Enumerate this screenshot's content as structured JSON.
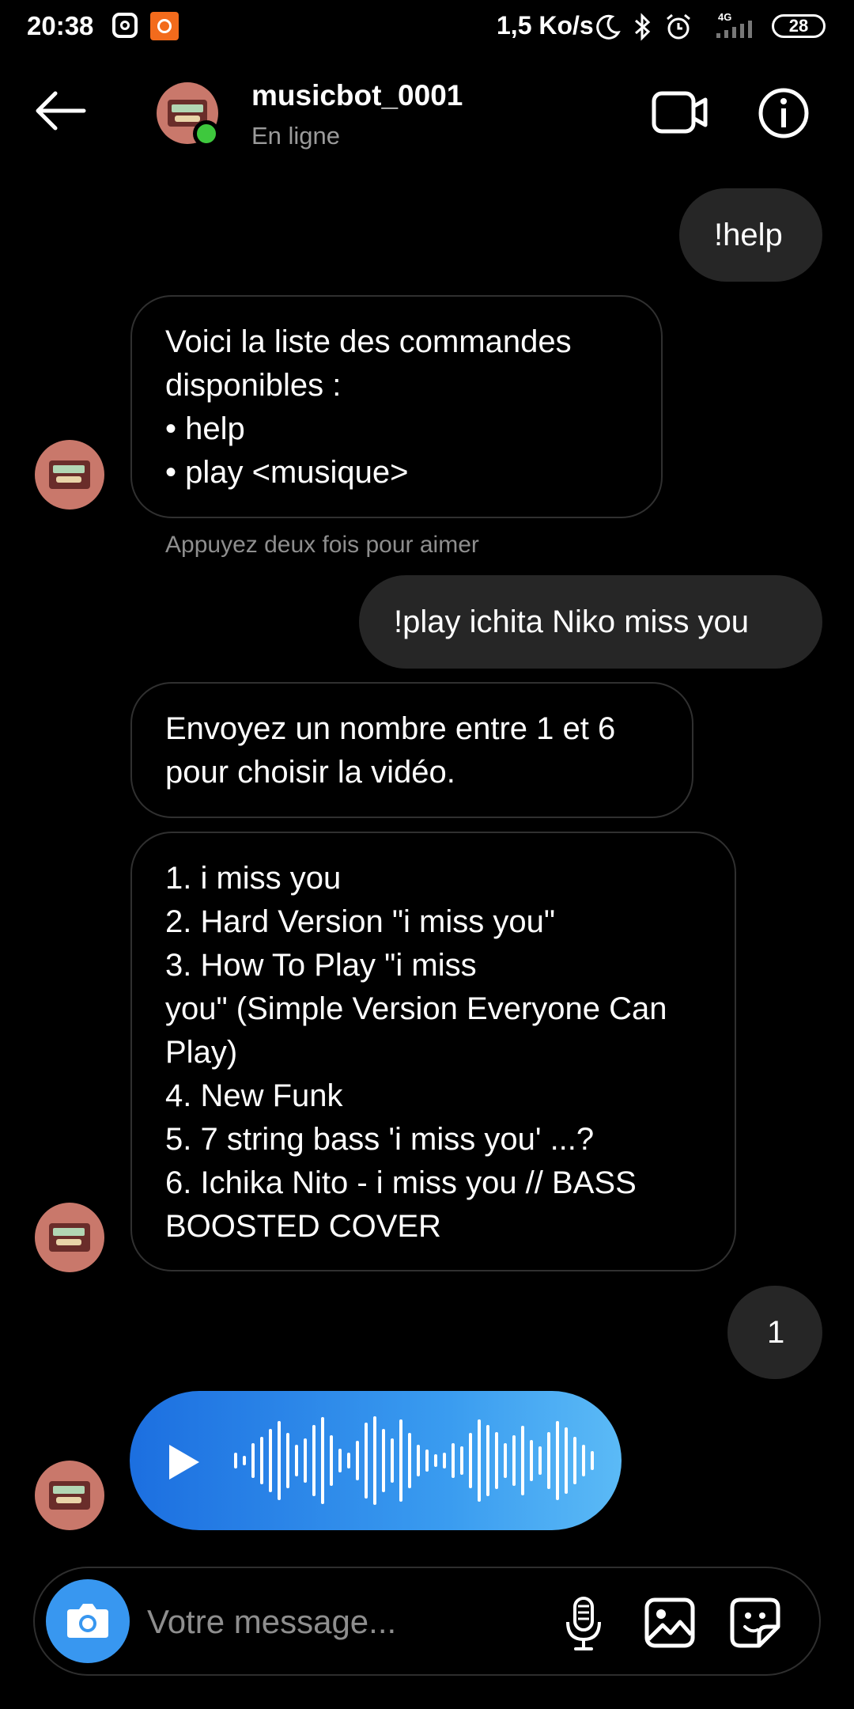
{
  "status_bar": {
    "time": "20:38",
    "net_speed": "1,5 Ko/s",
    "network_type": "4G",
    "battery": "28",
    "icons": [
      "instagram-icon",
      "mi-icon",
      "moon-icon",
      "bluetooth-icon",
      "alarm-icon",
      "signal-icon",
      "battery-icon"
    ]
  },
  "header": {
    "contact_name": "musicbot_0001",
    "contact_status": "En ligne",
    "online_color": "#3ec83d"
  },
  "messages": [
    {
      "from": "me",
      "text": "!help"
    },
    {
      "from": "bot",
      "lines": [
        "Voici la liste des commandes",
        "disponibles :",
        "• help",
        "• play <musique>"
      ]
    },
    {
      "from": "me",
      "text": "!play ichita Niko miss you"
    },
    {
      "from": "bot",
      "lines": [
        "Envoyez un nombre entre 1 et 6",
        "pour choisir la vidéo."
      ]
    },
    {
      "from": "bot",
      "lines": [
        "1. i miss you",
        "2. Hard Version \"i miss you\"",
        "3. How To Play \"i miss",
        "you\" (Simple Version Everyone Can",
        "Play)",
        "4. New Funk",
        "5. 7 string bass 'i miss you' ...?",
        "6. Ichika Nito - i miss you // BASS",
        "BOOSTED COVER"
      ]
    },
    {
      "from": "me",
      "text": "1"
    },
    {
      "from": "bot",
      "type": "voice"
    }
  ],
  "like_hint": "Appuyez deux fois pour aimer",
  "composer": {
    "placeholder": "Votre message..."
  },
  "colors": {
    "background": "#000000",
    "sent_bubble": "#262626",
    "voice_gradient_start": "#1c6fe0",
    "voice_gradient_end": "#5bbaf6",
    "camera_button": "#3897f0"
  }
}
